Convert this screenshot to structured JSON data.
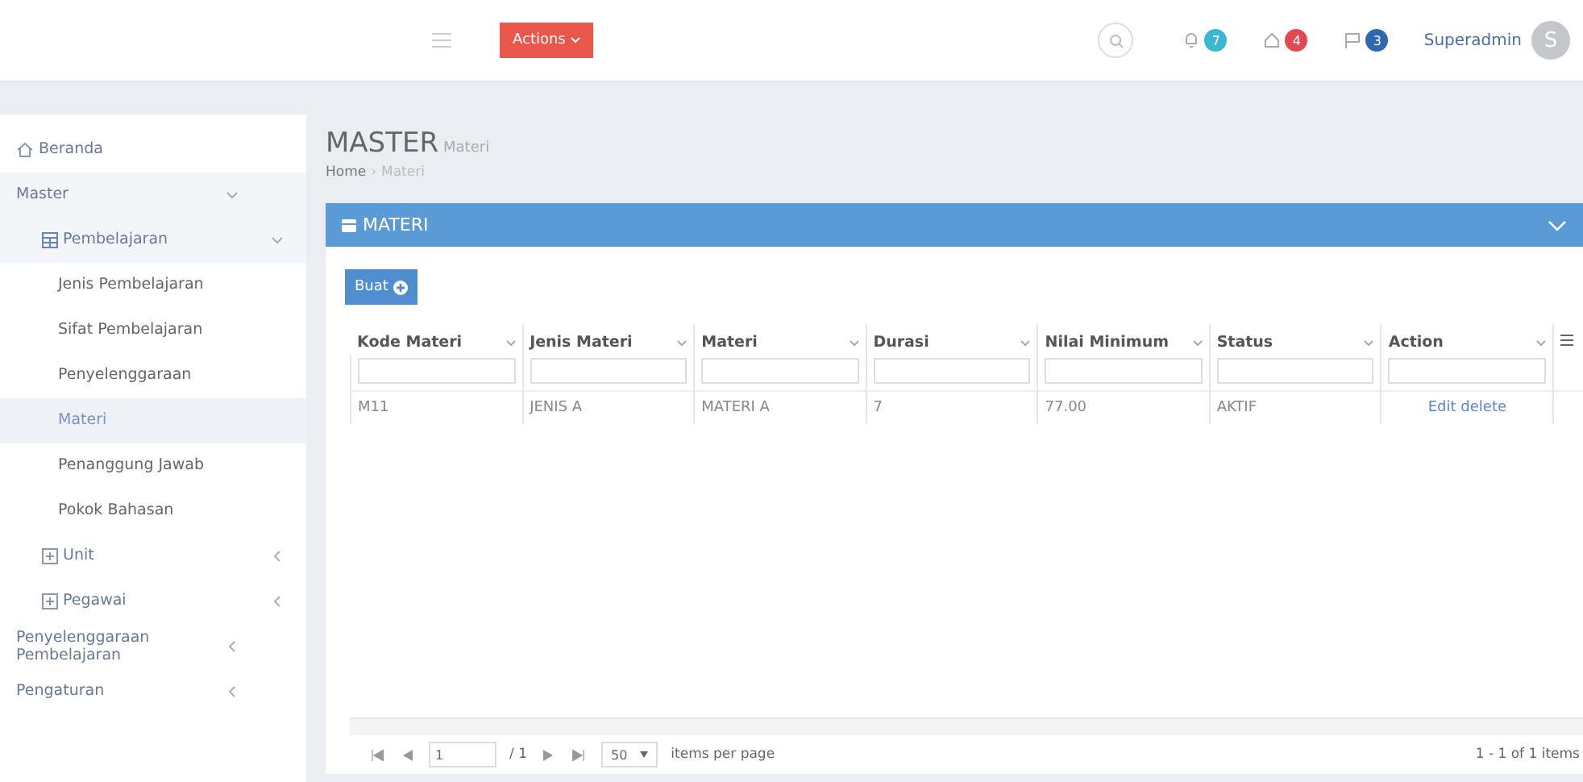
{
  "header": {
    "actions_button": "Actions",
    "notifications": [
      {
        "kind": "bell",
        "count": "7",
        "color": "#3bb8d0"
      },
      {
        "kind": "home",
        "count": "4",
        "color": "#e0494f"
      },
      {
        "kind": "flag",
        "count": "3",
        "color": "#2f67b0"
      }
    ],
    "user_name": "Superadmin",
    "avatar_letter": "S"
  },
  "sidebar": {
    "items": [
      {
        "label": "Beranda",
        "kind": "home",
        "selected": false
      },
      {
        "label": "Master",
        "expanded": true,
        "selected": false,
        "children": [
          {
            "label": "Pembelajaran",
            "kind": "grid",
            "expanded": true,
            "selected": false,
            "children": [
              {
                "label": "Jenis Pembelajaran",
                "selected": false
              },
              {
                "label": "Sifat Pembelajaran",
                "selected": false
              },
              {
                "label": "Penyelenggaraan",
                "selected": false
              },
              {
                "label": "Materi",
                "selected": true
              },
              {
                "label": "Penanggung Jawab",
                "selected": false
              },
              {
                "label": "Pokok Bahasan",
                "selected": false
              }
            ]
          },
          {
            "label": "Unit",
            "kind": "plus",
            "expanded": false,
            "selected": false
          },
          {
            "label": "Pegawai",
            "kind": "plus",
            "expanded": false,
            "selected": false
          }
        ]
      },
      {
        "label": "Penyelenggaraan Pembelajaran",
        "expanded": false,
        "selected": false
      },
      {
        "label": "Pengaturan",
        "expanded": false,
        "selected": false
      }
    ]
  },
  "page": {
    "title": "MASTER",
    "subtitle": "Materi",
    "breadcrumb": [
      "Home",
      "Materi"
    ],
    "breadcrumb_separator": "›"
  },
  "panel": {
    "title": "MATERI",
    "create_button": "Buat",
    "table": {
      "columns": [
        "Kode Materi",
        "Jenis Materi",
        "Materi",
        "Durasi",
        "Nilai Minimum",
        "Status",
        "Action"
      ],
      "rows": [
        {
          "cells": [
            "M11",
            "JENIS A",
            "MATERI A",
            "7",
            "77.00",
            "AKTIF"
          ],
          "actions": [
            "Edit",
            "delete"
          ]
        }
      ]
    },
    "pager": {
      "page": "1",
      "of": "/ 1",
      "page_size": "50",
      "per_page_label": "items per page",
      "summary": "1 - 1 of 1 items"
    }
  }
}
